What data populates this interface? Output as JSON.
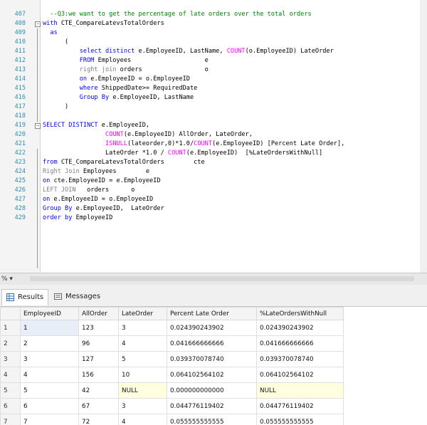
{
  "editor": {
    "lines": [
      {
        "num": "407",
        "tokens": [
          {
            "t": "  --Q3:we want to get the percentage of late orders over the total orders",
            "c": "cm"
          }
        ]
      },
      {
        "num": "408",
        "fold": "−",
        "tokens": [
          {
            "t": "with ",
            "c": "kw"
          },
          {
            "t": "CTE_CompareLatevsTotalOrders"
          }
        ]
      },
      {
        "num": "409",
        "tokens": [
          {
            "t": "  as",
            "c": "kw"
          }
        ]
      },
      {
        "num": "410",
        "tokens": [
          {
            "t": "      ("
          }
        ]
      },
      {
        "num": "411",
        "tokens": [
          {
            "t": "          select distinct ",
            "c": "kw"
          },
          {
            "t": "e.EmployeeID, LastName, "
          },
          {
            "t": "COUNT",
            "c": "fn"
          },
          {
            "t": "(o.EmployeeID) LateOrder"
          }
        ]
      },
      {
        "num": "412",
        "tokens": [
          {
            "t": "          FROM ",
            "c": "kw"
          },
          {
            "t": "Employees                    e"
          }
        ]
      },
      {
        "num": "413",
        "tokens": [
          {
            "t": "          right join ",
            "c": "gr"
          },
          {
            "t": "orders                 o"
          }
        ]
      },
      {
        "num": "414",
        "tokens": [
          {
            "t": "          on ",
            "c": "kw"
          },
          {
            "t": "e.EmployeeID = o.EmployeeID"
          }
        ]
      },
      {
        "num": "415",
        "tokens": [
          {
            "t": "          where ",
            "c": "kw"
          },
          {
            "t": "ShippedDate>= RequiredDate"
          }
        ]
      },
      {
        "num": "416",
        "tokens": [
          {
            "t": "          Group By ",
            "c": "kw"
          },
          {
            "t": "e.EmployeeID, LastName"
          }
        ]
      },
      {
        "num": "417",
        "tokens": [
          {
            "t": "      )"
          }
        ]
      },
      {
        "num": "418",
        "tokens": []
      },
      {
        "num": "419",
        "fold": "−",
        "tokens": [
          {
            "t": "SELECT DISTINCT ",
            "c": "kw"
          },
          {
            "t": "e.EmployeeID,"
          }
        ]
      },
      {
        "num": "420",
        "tokens": [
          {
            "t": "                 "
          },
          {
            "t": "COUNT",
            "c": "fn"
          },
          {
            "t": "(e.EmployeeID) AllOrder, LateOrder,"
          }
        ]
      },
      {
        "num": "421",
        "tokens": [
          {
            "t": "                 "
          },
          {
            "t": "ISNULL",
            "c": "fn"
          },
          {
            "t": "(lateorder,0)*1.0/"
          },
          {
            "t": "COUNT",
            "c": "fn"
          },
          {
            "t": "(e.EmployeeID) [Percent Late Order],"
          }
        ]
      },
      {
        "num": "422",
        "tokens": [
          {
            "t": "                 LateOrder *1.0 / "
          },
          {
            "t": "COUNT",
            "c": "fn"
          },
          {
            "t": "(e.EmployeeID)  [%LateOrdersWithNull]"
          }
        ]
      },
      {
        "num": "423",
        "tokens": [
          {
            "t": "from ",
            "c": "kw"
          },
          {
            "t": "CTE_CompareLatevsTotalOrders        cte"
          }
        ]
      },
      {
        "num": "424",
        "tokens": [
          {
            "t": "Right Join ",
            "c": "gr"
          },
          {
            "t": "Employees        e"
          }
        ]
      },
      {
        "num": "425",
        "tokens": [
          {
            "t": "on ",
            "c": "kw"
          },
          {
            "t": "cte.EmployeeID = e.EmployeeID"
          }
        ]
      },
      {
        "num": "426",
        "tokens": [
          {
            "t": "LEFT JOIN ",
            "c": "gr"
          },
          {
            "t": "  orders      o"
          }
        ]
      },
      {
        "num": "427",
        "tokens": [
          {
            "t": "on ",
            "c": "kw"
          },
          {
            "t": "e.EmployeeID = o.EmployeeID"
          }
        ]
      },
      {
        "num": "428",
        "tokens": [
          {
            "t": "Group By ",
            "c": "kw"
          },
          {
            "t": "e.EmployeeID,  LateOrder"
          }
        ]
      },
      {
        "num": "429",
        "tokens": [
          {
            "t": "order by ",
            "c": "kw"
          },
          {
            "t": "EmployeeID"
          }
        ]
      }
    ]
  },
  "zoom": "% ▾",
  "tabs": {
    "results": "Results",
    "messages": "Messages"
  },
  "grid": {
    "columns": [
      "",
      "EmployeeID",
      "AllOrder",
      "LateOrder",
      "Percent Late Order",
      "%LateOrdersWithNull"
    ],
    "rows": [
      [
        "1",
        "1",
        "123",
        "3",
        "0.024390243902",
        "0.024390243902"
      ],
      [
        "2",
        "2",
        "96",
        "4",
        "0.041666666666",
        "0.041666666666"
      ],
      [
        "3",
        "3",
        "127",
        "5",
        "0.039370078740",
        "0.039370078740"
      ],
      [
        "4",
        "4",
        "156",
        "10",
        "0.064102564102",
        "0.064102564102"
      ],
      [
        "5",
        "5",
        "42",
        "NULL",
        "0.000000000000",
        "NULL"
      ],
      [
        "6",
        "6",
        "67",
        "3",
        "0.044776119402",
        "0.044776119402"
      ],
      [
        "7",
        "7",
        "72",
        "4",
        "0.055555555555",
        "0.055555555555"
      ]
    ]
  },
  "colors": {
    "keyword": "#0000ff",
    "function": "#ff00ff",
    "comment": "#008000",
    "join": "#808080",
    "null_cell": "#ffffe0"
  }
}
